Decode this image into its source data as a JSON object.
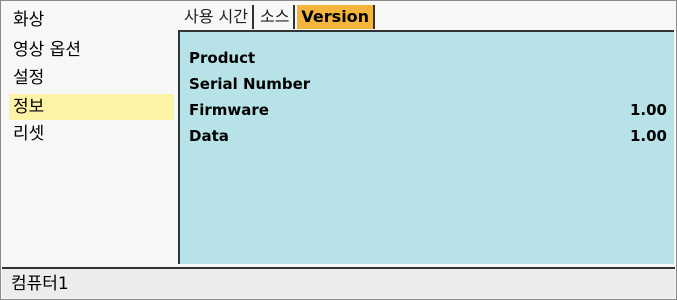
{
  "menu": {
    "items": [
      {
        "label": "화상"
      },
      {
        "label": "영상 옵션"
      },
      {
        "label": "설정"
      },
      {
        "label": "정보"
      },
      {
        "label": "리셋"
      }
    ]
  },
  "tabs": [
    {
      "label": "사용 시간"
    },
    {
      "label": "소스"
    },
    {
      "label": "Version"
    }
  ],
  "panel": {
    "rows": [
      {
        "label": "Product",
        "value": ""
      },
      {
        "label": "Serial Number",
        "value": ""
      },
      {
        "label": "Firmware",
        "value": "1.00"
      },
      {
        "label": "Data",
        "value": "1.00"
      }
    ]
  },
  "status": {
    "text": "컴퓨터1"
  },
  "colors": {
    "panel_bg": "#b6e2e8",
    "active_tab": "#f3b53c",
    "active_menu": "#fdf3a6"
  }
}
